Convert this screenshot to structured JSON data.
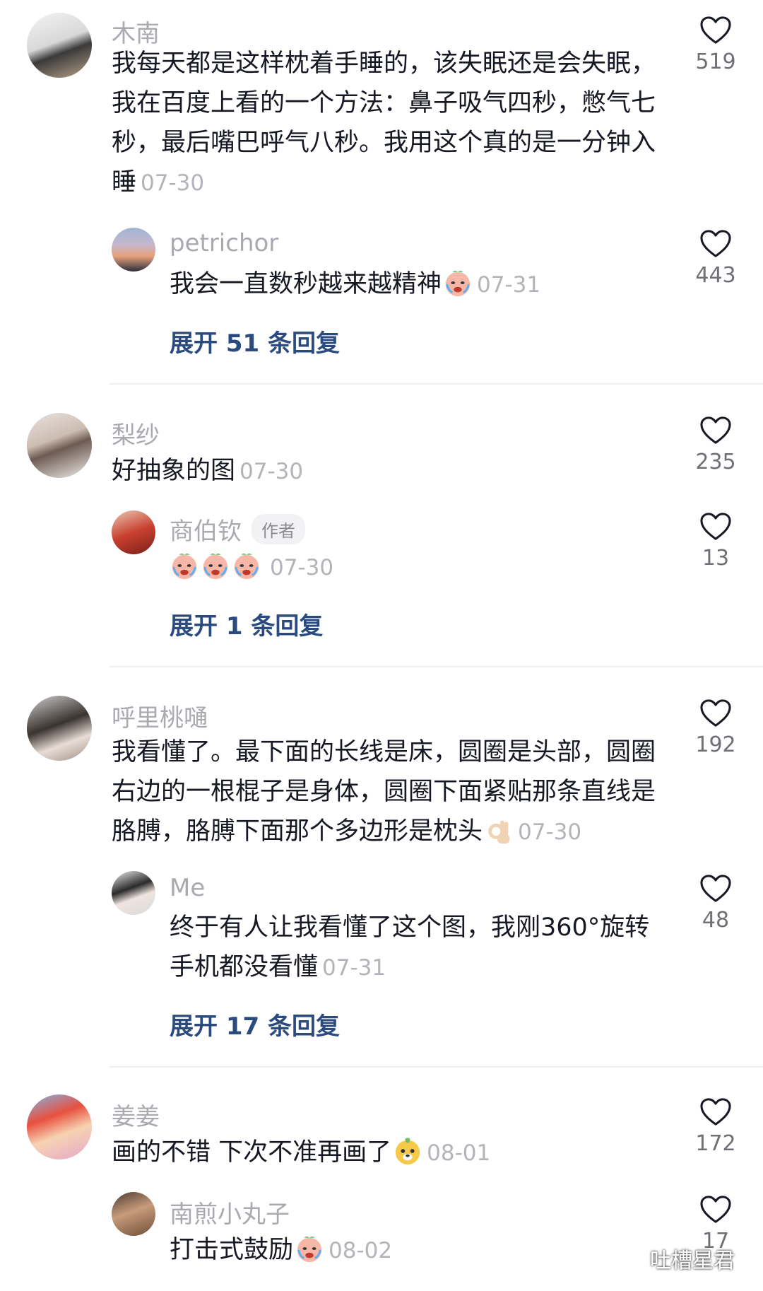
{
  "comments": [
    {
      "user": "木南",
      "text": "我每天都是这样枕着手睡的，该失眠还是会失眠，我在百度上看的一个方法：鼻子吸气四秒，憋气七秒，最后嘴巴呼气八秒。我用这个真的是一分钟入睡",
      "date": "07-30",
      "likes": "519",
      "reply": {
        "user": "petrichor",
        "text": "我会一直数秒越来越精神",
        "date": "07-31",
        "likes": "443"
      },
      "expand": "展开 51 条回复"
    },
    {
      "user": "梨纱",
      "text": "好抽象的图",
      "date": "07-30",
      "likes": "235",
      "reply": {
        "user": "商伯钦",
        "tag": "作者",
        "text": "",
        "date": "07-30",
        "likes": "13"
      },
      "expand": "展开 1 条回复"
    },
    {
      "user": "呼里桃嗵",
      "text": "我看懂了。最下面的长线是床，圆圈是头部，圆圈右边的一根棍子是身体，圆圈下面紧贴那条直线是胳膊，胳膊下面那个多边形是枕头",
      "date": "07-30",
      "likes": "192",
      "reply": {
        "user": "Me",
        "text": "终于有人让我看懂了这个图，我刚360°旋转手机都没看懂",
        "date": "07-31",
        "likes": "48"
      },
      "expand": "展开 17 条回复"
    },
    {
      "user": "姜姜",
      "text": "画的不错 下次不准再画了",
      "date": "08-01",
      "likes": "172",
      "reply": {
        "user": "南煎小丸子",
        "text": "打击式鼓励",
        "date": "08-02",
        "likes": "17"
      }
    }
  ],
  "watermark": "吐槽星君",
  "icons": {
    "like": "heart-outline-icon",
    "cry_emoji": "crying-emoji-icon",
    "ok_emoji": "ok-hand-emoji-icon",
    "dog_emoji": "dog-emoji-icon",
    "wechat": "wechat-icon"
  },
  "colors": {
    "expand": "#2b4a7e",
    "username": "#a8aab0",
    "date": "#b2b4b9"
  }
}
